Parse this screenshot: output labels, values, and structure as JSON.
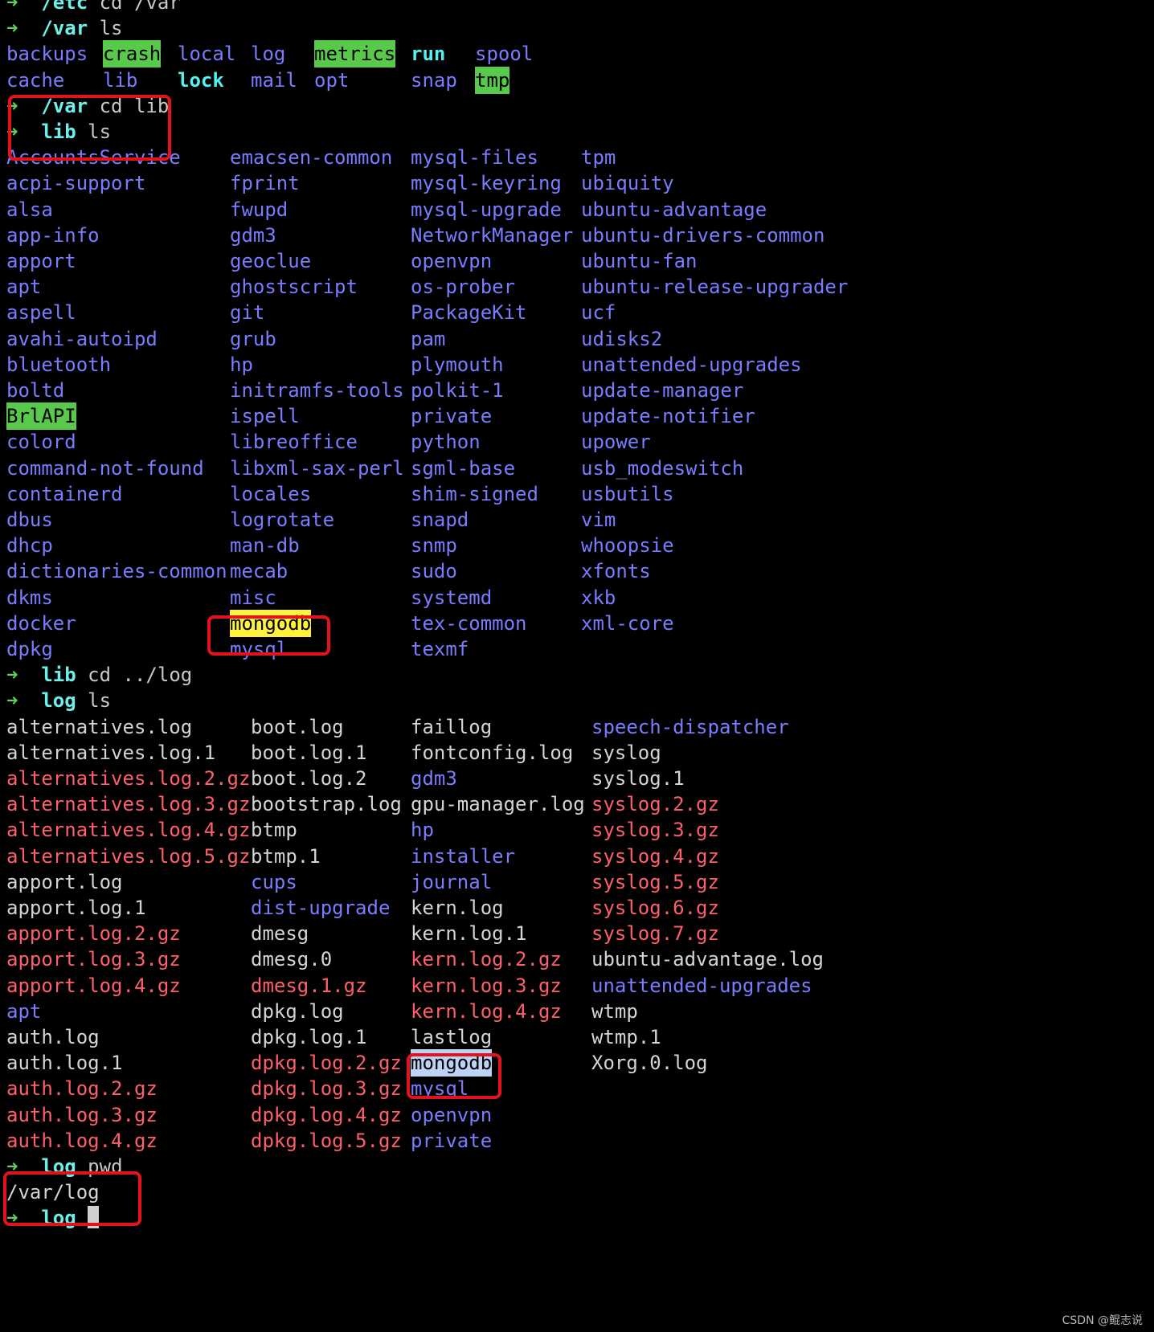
{
  "terminal": {
    "lines": [
      {
        "kind": "prompt",
        "dir": "/etc",
        "cmd": "cd /var"
      },
      {
        "kind": "prompt",
        "dir": "/var",
        "cmd": "ls"
      },
      {
        "kind": "ls",
        "cols": [
          0,
          120,
          213,
          304,
          383,
          503,
          583
        ],
        "items": [
          {
            "t": "backups",
            "c": "dir"
          },
          {
            "t": "crash",
            "c": "sticky"
          },
          {
            "t": "local",
            "c": "dir"
          },
          {
            "t": "log",
            "c": "dir"
          },
          {
            "t": "metrics",
            "c": "sticky"
          },
          {
            "t": "run",
            "c": "exec"
          },
          {
            "t": "spool",
            "c": "dir"
          }
        ]
      },
      {
        "kind": "ls",
        "cols": [
          0,
          120,
          213,
          304,
          383,
          503,
          583
        ],
        "items": [
          {
            "t": "cache",
            "c": "dir"
          },
          {
            "t": "lib",
            "c": "dir"
          },
          {
            "t": "lock",
            "c": "exec"
          },
          {
            "t": "mail",
            "c": "dir"
          },
          {
            "t": "opt",
            "c": "dir"
          },
          {
            "t": "snap",
            "c": "dir"
          },
          {
            "t": "tmp",
            "c": "sticky"
          }
        ]
      },
      {
        "kind": "prompt",
        "dir": "/var",
        "cmd": "cd lib"
      },
      {
        "kind": "prompt",
        "dir": "lib",
        "cmd": "ls"
      },
      {
        "kind": "ls",
        "cols": [
          0,
          278,
          503,
          715
        ],
        "items": [
          {
            "t": "AccountsService",
            "c": "dir"
          },
          {
            "t": "emacsen-common",
            "c": "dir"
          },
          {
            "t": "mysql-files",
            "c": "dir"
          },
          {
            "t": "tpm",
            "c": "dir"
          }
        ]
      },
      {
        "kind": "ls",
        "cols": [
          0,
          278,
          503,
          715
        ],
        "items": [
          {
            "t": "acpi-support",
            "c": "dir"
          },
          {
            "t": "fprint",
            "c": "dir"
          },
          {
            "t": "mysql-keyring",
            "c": "dir"
          },
          {
            "t": "ubiquity",
            "c": "dir"
          }
        ]
      },
      {
        "kind": "ls",
        "cols": [
          0,
          278,
          503,
          715
        ],
        "items": [
          {
            "t": "alsa",
            "c": "dir"
          },
          {
            "t": "fwupd",
            "c": "dir"
          },
          {
            "t": "mysql-upgrade",
            "c": "dir"
          },
          {
            "t": "ubuntu-advantage",
            "c": "dir"
          }
        ]
      },
      {
        "kind": "ls",
        "cols": [
          0,
          278,
          503,
          715
        ],
        "items": [
          {
            "t": "app-info",
            "c": "dir"
          },
          {
            "t": "gdm3",
            "c": "dir"
          },
          {
            "t": "NetworkManager",
            "c": "dir"
          },
          {
            "t": "ubuntu-drivers-common",
            "c": "dir"
          }
        ]
      },
      {
        "kind": "ls",
        "cols": [
          0,
          278,
          503,
          715
        ],
        "items": [
          {
            "t": "apport",
            "c": "dir"
          },
          {
            "t": "geoclue",
            "c": "dir"
          },
          {
            "t": "openvpn",
            "c": "dir"
          },
          {
            "t": "ubuntu-fan",
            "c": "dir"
          }
        ]
      },
      {
        "kind": "ls",
        "cols": [
          0,
          278,
          503,
          715
        ],
        "items": [
          {
            "t": "apt",
            "c": "dir"
          },
          {
            "t": "ghostscript",
            "c": "dir"
          },
          {
            "t": "os-prober",
            "c": "dir"
          },
          {
            "t": "ubuntu-release-upgrader",
            "c": "dir"
          }
        ]
      },
      {
        "kind": "ls",
        "cols": [
          0,
          278,
          503,
          715
        ],
        "items": [
          {
            "t": "aspell",
            "c": "dir"
          },
          {
            "t": "git",
            "c": "dir"
          },
          {
            "t": "PackageKit",
            "c": "dir"
          },
          {
            "t": "ucf",
            "c": "dir"
          }
        ]
      },
      {
        "kind": "ls",
        "cols": [
          0,
          278,
          503,
          715
        ],
        "items": [
          {
            "t": "avahi-autoipd",
            "c": "dir"
          },
          {
            "t": "grub",
            "c": "dir"
          },
          {
            "t": "pam",
            "c": "dir"
          },
          {
            "t": "udisks2",
            "c": "dir"
          }
        ]
      },
      {
        "kind": "ls",
        "cols": [
          0,
          278,
          503,
          715
        ],
        "items": [
          {
            "t": "bluetooth",
            "c": "dir"
          },
          {
            "t": "hp",
            "c": "dir"
          },
          {
            "t": "plymouth",
            "c": "dir"
          },
          {
            "t": "unattended-upgrades",
            "c": "dir"
          }
        ]
      },
      {
        "kind": "ls",
        "cols": [
          0,
          278,
          503,
          715
        ],
        "items": [
          {
            "t": "boltd",
            "c": "dir"
          },
          {
            "t": "initramfs-tools",
            "c": "dir"
          },
          {
            "t": "polkit-1",
            "c": "dir"
          },
          {
            "t": "update-manager",
            "c": "dir"
          }
        ]
      },
      {
        "kind": "ls",
        "cols": [
          0,
          278,
          503,
          715
        ],
        "items": [
          {
            "t": "BrlAPI",
            "c": "sticky"
          },
          {
            "t": "ispell",
            "c": "dir"
          },
          {
            "t": "private",
            "c": "dir"
          },
          {
            "t": "update-notifier",
            "c": "dir"
          }
        ]
      },
      {
        "kind": "ls",
        "cols": [
          0,
          278,
          503,
          715
        ],
        "items": [
          {
            "t": "colord",
            "c": "dir"
          },
          {
            "t": "libreoffice",
            "c": "dir"
          },
          {
            "t": "python",
            "c": "dir"
          },
          {
            "t": "upower",
            "c": "dir"
          }
        ]
      },
      {
        "kind": "ls",
        "cols": [
          0,
          278,
          503,
          715
        ],
        "items": [
          {
            "t": "command-not-found",
            "c": "dir"
          },
          {
            "t": "libxml-sax-perl",
            "c": "dir"
          },
          {
            "t": "sgml-base",
            "c": "dir"
          },
          {
            "t": "usb_modeswitch",
            "c": "dir"
          }
        ]
      },
      {
        "kind": "ls",
        "cols": [
          0,
          278,
          503,
          715
        ],
        "items": [
          {
            "t": "containerd",
            "c": "dir"
          },
          {
            "t": "locales",
            "c": "dir"
          },
          {
            "t": "shim-signed",
            "c": "dir"
          },
          {
            "t": "usbutils",
            "c": "dir"
          }
        ]
      },
      {
        "kind": "ls",
        "cols": [
          0,
          278,
          503,
          715
        ],
        "items": [
          {
            "t": "dbus",
            "c": "dir"
          },
          {
            "t": "logrotate",
            "c": "dir"
          },
          {
            "t": "snapd",
            "c": "dir"
          },
          {
            "t": "vim",
            "c": "dir"
          }
        ]
      },
      {
        "kind": "ls",
        "cols": [
          0,
          278,
          503,
          715
        ],
        "items": [
          {
            "t": "dhcp",
            "c": "dir"
          },
          {
            "t": "man-db",
            "c": "dir"
          },
          {
            "t": "snmp",
            "c": "dir"
          },
          {
            "t": "whoopsie",
            "c": "dir"
          }
        ]
      },
      {
        "kind": "ls",
        "cols": [
          0,
          278,
          503,
          715
        ],
        "items": [
          {
            "t": "dictionaries-common",
            "c": "dir"
          },
          {
            "t": "mecab",
            "c": "dir"
          },
          {
            "t": "sudo",
            "c": "dir"
          },
          {
            "t": "xfonts",
            "c": "dir"
          }
        ]
      },
      {
        "kind": "ls",
        "cols": [
          0,
          278,
          503,
          715
        ],
        "items": [
          {
            "t": "dkms",
            "c": "dir"
          },
          {
            "t": "misc",
            "c": "dir"
          },
          {
            "t": "systemd",
            "c": "dir"
          },
          {
            "t": "xkb",
            "c": "dir"
          }
        ]
      },
      {
        "kind": "ls",
        "cols": [
          0,
          278,
          503,
          715
        ],
        "items": [
          {
            "t": "docker",
            "c": "dir"
          },
          {
            "t": "mongodb",
            "c": "hl-yellow"
          },
          {
            "t": "tex-common",
            "c": "dir"
          },
          {
            "t": "xml-core",
            "c": "dir"
          }
        ]
      },
      {
        "kind": "ls",
        "cols": [
          0,
          278,
          503
        ],
        "items": [
          {
            "t": "dpkg",
            "c": "dir"
          },
          {
            "t": "mysql",
            "c": "dir"
          },
          {
            "t": "texmf",
            "c": "dir"
          }
        ]
      },
      {
        "kind": "prompt",
        "dir": "lib",
        "cmd": "cd ../log"
      },
      {
        "kind": "prompt",
        "dir": "log",
        "cmd": "ls"
      },
      {
        "kind": "ls",
        "cols": [
          0,
          304,
          503,
          728
        ],
        "items": [
          {
            "t": "alternatives.log",
            "c": "file"
          },
          {
            "t": "boot.log",
            "c": "file"
          },
          {
            "t": "faillog",
            "c": "file"
          },
          {
            "t": "speech-dispatcher",
            "c": "dir"
          }
        ]
      },
      {
        "kind": "ls",
        "cols": [
          0,
          304,
          503,
          728
        ],
        "items": [
          {
            "t": "alternatives.log.1",
            "c": "file"
          },
          {
            "t": "boot.log.1",
            "c": "file"
          },
          {
            "t": "fontconfig.log",
            "c": "file"
          },
          {
            "t": "syslog",
            "c": "file"
          }
        ]
      },
      {
        "kind": "ls",
        "cols": [
          0,
          304,
          503,
          728
        ],
        "items": [
          {
            "t": "alternatives.log.2.gz",
            "c": "gz"
          },
          {
            "t": "boot.log.2",
            "c": "file"
          },
          {
            "t": "gdm3",
            "c": "dir"
          },
          {
            "t": "syslog.1",
            "c": "file"
          }
        ]
      },
      {
        "kind": "ls",
        "cols": [
          0,
          304,
          503,
          728
        ],
        "items": [
          {
            "t": "alternatives.log.3.gz",
            "c": "gz"
          },
          {
            "t": "bootstrap.log",
            "c": "file"
          },
          {
            "t": "gpu-manager.log",
            "c": "file"
          },
          {
            "t": "syslog.2.gz",
            "c": "gz"
          }
        ]
      },
      {
        "kind": "ls",
        "cols": [
          0,
          304,
          503,
          728
        ],
        "items": [
          {
            "t": "alternatives.log.4.gz",
            "c": "gz"
          },
          {
            "t": "btmp",
            "c": "file"
          },
          {
            "t": "hp",
            "c": "dir"
          },
          {
            "t": "syslog.3.gz",
            "c": "gz"
          }
        ]
      },
      {
        "kind": "ls",
        "cols": [
          0,
          304,
          503,
          728
        ],
        "items": [
          {
            "t": "alternatives.log.5.gz",
            "c": "gz"
          },
          {
            "t": "btmp.1",
            "c": "file"
          },
          {
            "t": "installer",
            "c": "dir"
          },
          {
            "t": "syslog.4.gz",
            "c": "gz"
          }
        ]
      },
      {
        "kind": "ls",
        "cols": [
          0,
          304,
          503,
          728
        ],
        "items": [
          {
            "t": "apport.log",
            "c": "file"
          },
          {
            "t": "cups",
            "c": "dir"
          },
          {
            "t": "journal",
            "c": "dir"
          },
          {
            "t": "syslog.5.gz",
            "c": "gz"
          }
        ]
      },
      {
        "kind": "ls",
        "cols": [
          0,
          304,
          503,
          728
        ],
        "items": [
          {
            "t": "apport.log.1",
            "c": "file"
          },
          {
            "t": "dist-upgrade",
            "c": "dir"
          },
          {
            "t": "kern.log",
            "c": "file"
          },
          {
            "t": "syslog.6.gz",
            "c": "gz"
          }
        ]
      },
      {
        "kind": "ls",
        "cols": [
          0,
          304,
          503,
          728
        ],
        "items": [
          {
            "t": "apport.log.2.gz",
            "c": "gz"
          },
          {
            "t": "dmesg",
            "c": "file"
          },
          {
            "t": "kern.log.1",
            "c": "file"
          },
          {
            "t": "syslog.7.gz",
            "c": "gz"
          }
        ]
      },
      {
        "kind": "ls",
        "cols": [
          0,
          304,
          503,
          728
        ],
        "items": [
          {
            "t": "apport.log.3.gz",
            "c": "gz"
          },
          {
            "t": "dmesg.0",
            "c": "file"
          },
          {
            "t": "kern.log.2.gz",
            "c": "gz"
          },
          {
            "t": "ubuntu-advantage.log",
            "c": "file"
          }
        ]
      },
      {
        "kind": "ls",
        "cols": [
          0,
          304,
          503,
          728
        ],
        "items": [
          {
            "t": "apport.log.4.gz",
            "c": "gz"
          },
          {
            "t": "dmesg.1.gz",
            "c": "gz"
          },
          {
            "t": "kern.log.3.gz",
            "c": "gz"
          },
          {
            "t": "unattended-upgrades",
            "c": "dir"
          }
        ]
      },
      {
        "kind": "ls",
        "cols": [
          0,
          304,
          503,
          728
        ],
        "items": [
          {
            "t": "apt",
            "c": "dir"
          },
          {
            "t": "dpkg.log",
            "c": "file"
          },
          {
            "t": "kern.log.4.gz",
            "c": "gz"
          },
          {
            "t": "wtmp",
            "c": "file"
          }
        ]
      },
      {
        "kind": "ls",
        "cols": [
          0,
          304,
          503,
          728
        ],
        "items": [
          {
            "t": "auth.log",
            "c": "file"
          },
          {
            "t": "dpkg.log.1",
            "c": "file"
          },
          {
            "t": "lastlog",
            "c": "file"
          },
          {
            "t": "wtmp.1",
            "c": "file"
          }
        ]
      },
      {
        "kind": "ls",
        "cols": [
          0,
          304,
          503,
          728
        ],
        "items": [
          {
            "t": "auth.log.1",
            "c": "file"
          },
          {
            "t": "dpkg.log.2.gz",
            "c": "gz"
          },
          {
            "t": "mongodb",
            "c": "hl-blue"
          },
          {
            "t": "Xorg.0.log",
            "c": "file"
          }
        ]
      },
      {
        "kind": "ls",
        "cols": [
          0,
          304,
          503
        ],
        "items": [
          {
            "t": "auth.log.2.gz",
            "c": "gz"
          },
          {
            "t": "dpkg.log.3.gz",
            "c": "gz"
          },
          {
            "t": "mysql",
            "c": "dir"
          }
        ]
      },
      {
        "kind": "ls",
        "cols": [
          0,
          304,
          503
        ],
        "items": [
          {
            "t": "auth.log.3.gz",
            "c": "gz"
          },
          {
            "t": "dpkg.log.4.gz",
            "c": "gz"
          },
          {
            "t": "openvpn",
            "c": "dir"
          }
        ]
      },
      {
        "kind": "ls",
        "cols": [
          0,
          304,
          503
        ],
        "items": [
          {
            "t": "auth.log.4.gz",
            "c": "gz"
          },
          {
            "t": "dpkg.log.5.gz",
            "c": "gz"
          },
          {
            "t": "private",
            "c": "dir"
          }
        ]
      },
      {
        "kind": "prompt",
        "dir": "log",
        "cmd": "pwd"
      },
      {
        "kind": "output",
        "text": "/var/log"
      },
      {
        "kind": "prompt",
        "dir": "log",
        "cmd": "",
        "cursor": true
      }
    ]
  },
  "annotation_color": "#e3121b",
  "watermark": "CSDN @鲲志说"
}
